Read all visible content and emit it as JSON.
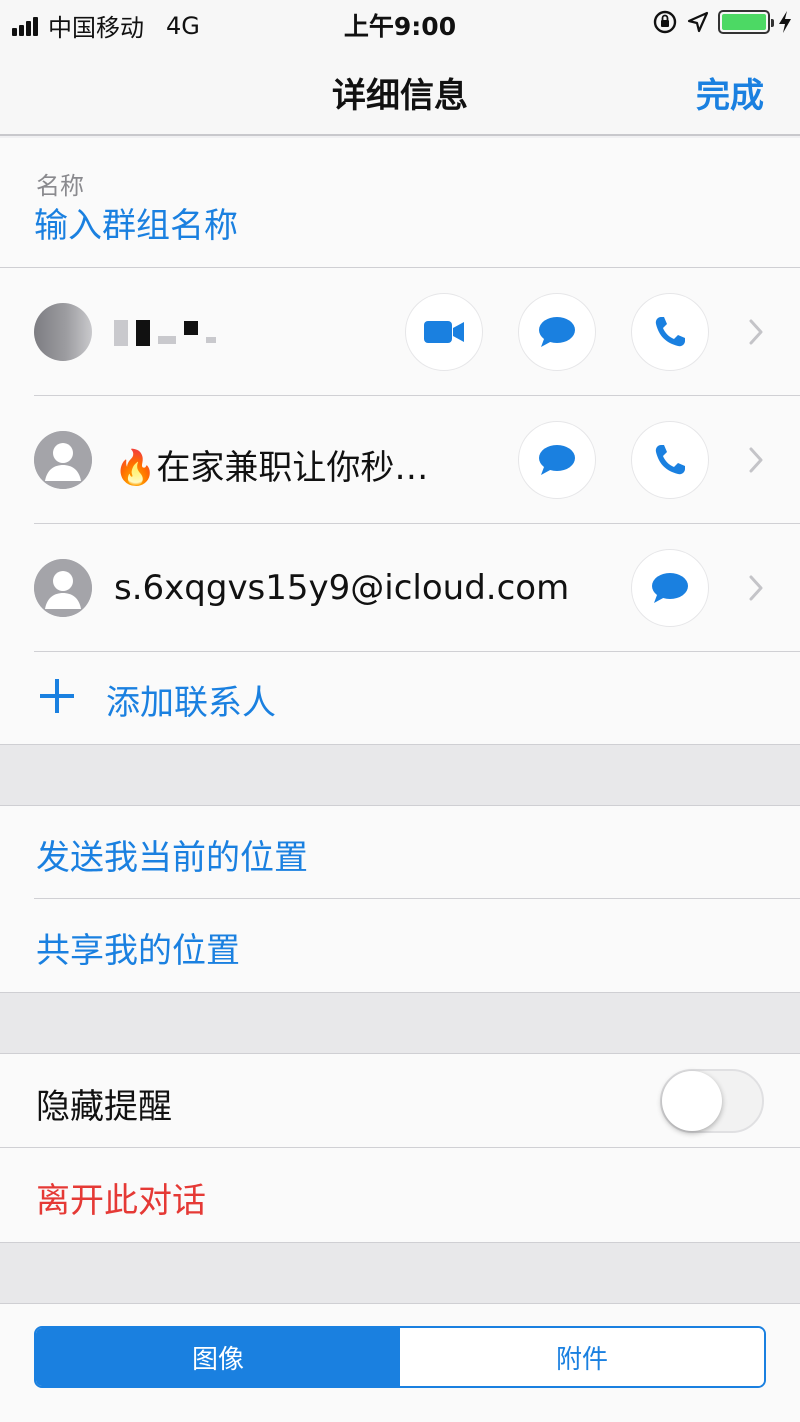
{
  "status_bar": {
    "carrier": "中国移动",
    "network": "4G",
    "time": "上午9:00",
    "battery_level": 1.0
  },
  "nav": {
    "title": "详细信息",
    "done_label": "完成"
  },
  "group_name": {
    "label": "名称",
    "placeholder": "输入群组名称",
    "value": ""
  },
  "contacts": [
    {
      "name": "",
      "name_redacted": true,
      "avatar": "blurred-photo",
      "actions": [
        "video-icon",
        "message-icon",
        "phone-icon"
      ]
    },
    {
      "name": "🔥在家兼职让你秒…",
      "avatar": "person-placeholder-icon",
      "actions": [
        "message-icon",
        "phone-icon"
      ]
    },
    {
      "name": "s.6xqgvs15y9@icloud.com",
      "avatar": "person-placeholder-icon",
      "actions": [
        "message-icon"
      ]
    }
  ],
  "add_contact_label": "添加联系人",
  "location": {
    "send_current": "发送我当前的位置",
    "share": "共享我的位置"
  },
  "options": {
    "hide_alerts_label": "隐藏提醒",
    "hide_alerts_on": false,
    "leave_label": "离开此对话"
  },
  "segment": {
    "items": [
      "图像",
      "附件"
    ],
    "selected": "图像"
  },
  "colors": {
    "accent": "#1a80e0",
    "destructive": "#e53935",
    "toggle_off": "#f2f2f2"
  }
}
